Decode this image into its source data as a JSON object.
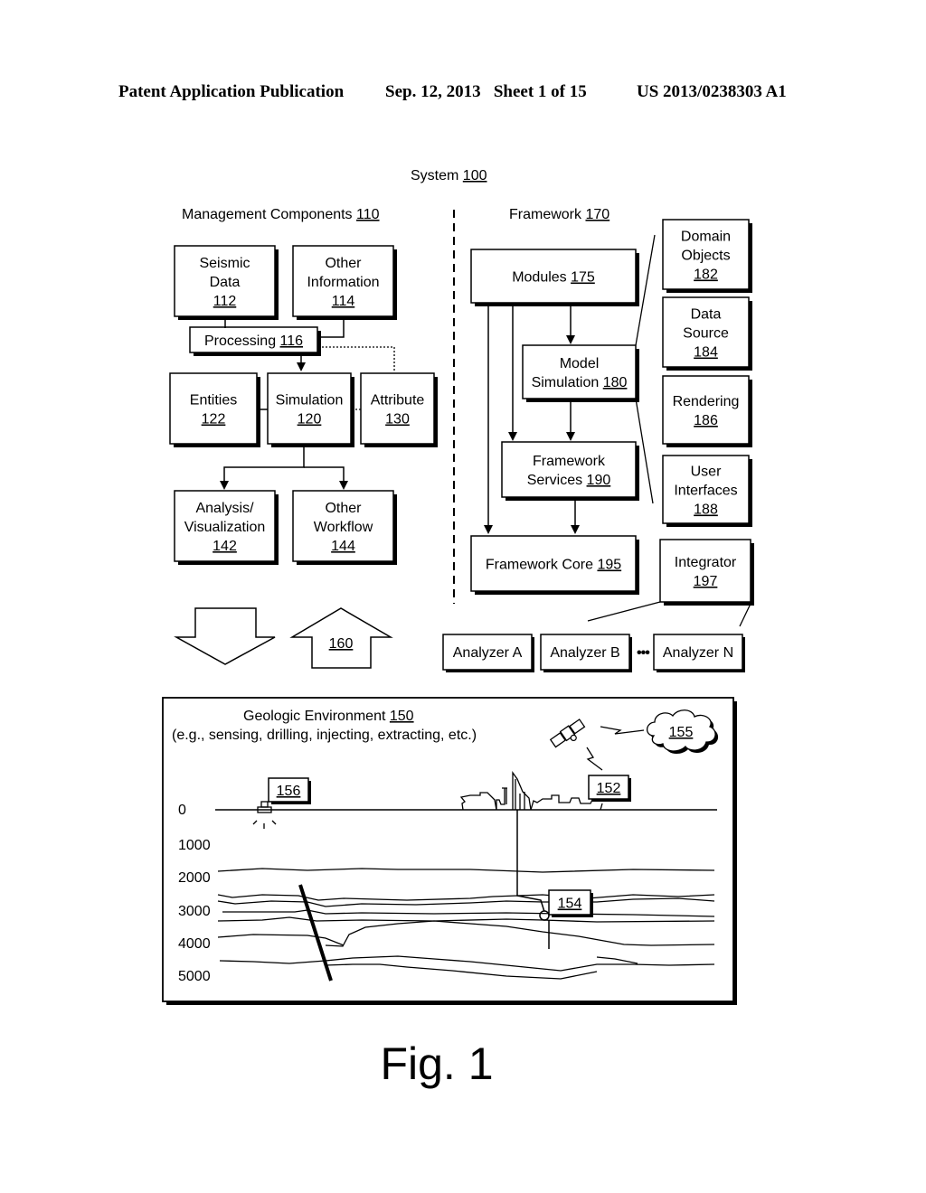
{
  "header": {
    "publication": "Patent Application Publication",
    "date_sheet": "Sep. 12, 2013   Sheet 1 of 15",
    "number": "US 2013/0238303 A1"
  },
  "system": {
    "label": "System",
    "ref": "100"
  },
  "management": {
    "label": "Management Components",
    "ref": "110",
    "seismic": {
      "lines": [
        "Seismic",
        "Data"
      ],
      "ref": "112"
    },
    "other_info": {
      "lines": [
        "Other",
        "Information"
      ],
      "ref": "114"
    },
    "processing": {
      "label": "Processing",
      "ref": "116"
    },
    "entities": {
      "lines": [
        "Entities"
      ],
      "ref": "122"
    },
    "simulation": {
      "lines": [
        "Simulation"
      ],
      "ref": "120"
    },
    "attribute": {
      "lines": [
        "Attribute"
      ],
      "ref": "130"
    },
    "analysis": {
      "lines": [
        "Analysis/",
        "Visualization"
      ],
      "ref": "142"
    },
    "workflow": {
      "lines": [
        "Other",
        "Workflow"
      ],
      "ref": "144"
    },
    "arrow_ref": "160"
  },
  "framework": {
    "label": "Framework",
    "ref": "170",
    "modules": {
      "label": "Modules",
      "ref": "175"
    },
    "model_sim": {
      "lines": [
        "Model",
        "Simulation"
      ],
      "ref": "180"
    },
    "services": {
      "lines": [
        "Framework",
        "Services"
      ],
      "ref": "190"
    },
    "core": {
      "label": "Framework Core",
      "ref": "195"
    },
    "domain_objects": {
      "lines": [
        "Domain",
        "Objects"
      ],
      "ref": "182"
    },
    "data_source": {
      "lines": [
        "Data",
        "Source"
      ],
      "ref": "184"
    },
    "rendering": {
      "lines": [
        "Rendering"
      ],
      "ref": "186"
    },
    "user_interfaces": {
      "lines": [
        "User",
        "Interfaces"
      ],
      "ref": "188"
    },
    "integrator": {
      "lines": [
        "Integrator"
      ],
      "ref": "197"
    },
    "analyzers": [
      "Analyzer A",
      "Analyzer B",
      "Analyzer N"
    ],
    "ellipsis": "•••"
  },
  "geologic": {
    "title": "Geologic Environment",
    "ref": "150",
    "subtitle": "(e.g., sensing, drilling, injecting, extracting, etc.)",
    "depths": [
      "0",
      "1000",
      "2000",
      "3000",
      "4000",
      "5000"
    ],
    "callouts": {
      "sensor": "156",
      "rig": "152",
      "cloud": "155",
      "well": "154"
    }
  },
  "figure": {
    "caption": "Fig. 1"
  }
}
